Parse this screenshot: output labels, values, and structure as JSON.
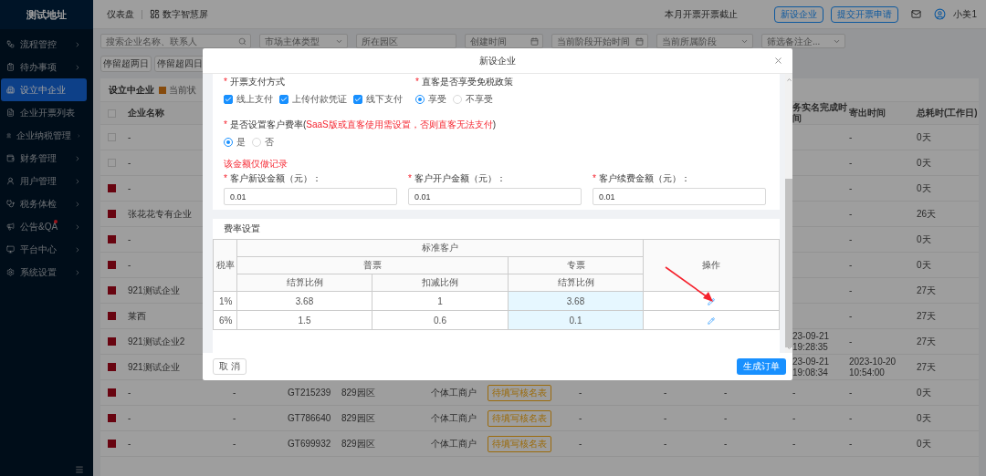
{
  "sidebar": {
    "title": "测试地址",
    "items": [
      {
        "label": "流程管控",
        "selected": false,
        "expandable": true,
        "badge": false
      },
      {
        "label": "待办事项",
        "selected": false,
        "expandable": true,
        "badge": false
      },
      {
        "label": "设立中企业",
        "selected": true,
        "expandable": false,
        "badge": false
      },
      {
        "label": "企业开票列表",
        "selected": false,
        "expandable": false,
        "badge": false
      },
      {
        "label": "企业纳税管理",
        "selected": false,
        "expandable": true,
        "badge": false
      },
      {
        "label": "财务管理",
        "selected": false,
        "expandable": true,
        "badge": false
      },
      {
        "label": "用户管理",
        "selected": false,
        "expandable": true,
        "badge": false
      },
      {
        "label": "税务体检",
        "selected": false,
        "expandable": true,
        "badge": false
      },
      {
        "label": "公告&QA",
        "selected": false,
        "expandable": true,
        "badge": true
      },
      {
        "label": "平台中心",
        "selected": false,
        "expandable": true,
        "badge": false
      },
      {
        "label": "系统设置",
        "selected": false,
        "expandable": true,
        "badge": false
      }
    ]
  },
  "header": {
    "tabs": [
      {
        "label": "仪表盘",
        "kind": "text"
      },
      {
        "label": "数字智慧屏",
        "kind": "screen"
      }
    ],
    "notice": "本月开票开票截止",
    "buttons": [
      "新设企业",
      "提交开票申请"
    ],
    "user": "小美1"
  },
  "filters": {
    "search": {
      "placeholder": "搜索企业名称、联系人"
    },
    "fields": [
      {
        "kind": "select",
        "placeholder": "市场主体类型"
      },
      {
        "kind": "text",
        "placeholder": "所在园区"
      },
      {
        "kind": "date",
        "placeholder": "创建时间"
      },
      {
        "kind": "date",
        "placeholder": "当前阶段开始时间"
      },
      {
        "kind": "select",
        "placeholder": "当前所属阶段"
      },
      {
        "kind": "select",
        "placeholder": "筛选备注企..."
      }
    ],
    "quick_buttons": [
      "停留超两日",
      "停留超四日"
    ]
  },
  "list": {
    "title": "设立中企业",
    "legend": "当前状",
    "select_all": {
      "checked": false
    },
    "headers": {
      "name": "企业名称",
      "column_9": "务实名完成时间",
      "column_10": "寄出时间",
      "column_11": "总耗时(工作日)"
    },
    "rows": [
      {
        "marked": false,
        "name": "-",
        "column_10": "-",
        "column_11": "0天"
      },
      {
        "marked": false,
        "name": "-",
        "column_10": "-",
        "column_11": "0天"
      },
      {
        "marked": true,
        "name": "-",
        "column_10": "-",
        "column_11": "0天"
      },
      {
        "marked": true,
        "name": "张花花专有企业",
        "column_10": "-",
        "column_11": "26天"
      },
      {
        "marked": true,
        "name": "-",
        "column_10": "-",
        "column_11": "0天"
      },
      {
        "marked": true,
        "name": "-",
        "column_10": "-",
        "column_11": "0天"
      },
      {
        "marked": true,
        "name": "921测试企业",
        "column_10": "-",
        "column_11": "27天"
      },
      {
        "marked": true,
        "name": "莱西",
        "column_10": "-",
        "column_11": "27天"
      },
      {
        "marked": true,
        "name": "921测试企业2",
        "column_9": "23-09-21 19:28:35",
        "column_10": "-",
        "column_11": "27天"
      },
      {
        "marked": true,
        "name": "921测试企业",
        "column_9": "23-09-21 19:08:34",
        "column_10": "2023-10-20 10:54:00",
        "column_11": "27天"
      },
      {
        "marked": true,
        "name": "-",
        "middle": [
          {
            "kind": "text",
            "text": "-"
          },
          {
            "kind": "text",
            "text": "GT215239"
          },
          {
            "kind": "text",
            "text": "829园区"
          },
          {
            "kind": "text",
            "text": "个体工商户"
          },
          {
            "kind": "tag",
            "text": "待填写核名表"
          },
          {
            "kind": "text",
            "text": "-"
          },
          {
            "kind": "text",
            "text": "-"
          },
          {
            "kind": "text",
            "text": "-"
          }
        ],
        "column_9": "-",
        "column_10": "-",
        "column_11": "0天"
      },
      {
        "marked": true,
        "name": "-",
        "middle": [
          {
            "kind": "text",
            "text": "-"
          },
          {
            "kind": "text",
            "text": "GT786640"
          },
          {
            "kind": "text",
            "text": "829园区"
          },
          {
            "kind": "text",
            "text": "个体工商户"
          },
          {
            "kind": "tag",
            "text": "待填写核名表"
          },
          {
            "kind": "text",
            "text": "-"
          },
          {
            "kind": "text",
            "text": "-"
          },
          {
            "kind": "text",
            "text": "-"
          }
        ],
        "column_9": "-",
        "column_10": "-",
        "column_11": "0天"
      },
      {
        "marked": true,
        "name": "-",
        "middle": [
          {
            "kind": "text",
            "text": "-"
          },
          {
            "kind": "text",
            "text": "GT699932"
          },
          {
            "kind": "text",
            "text": "829园区"
          },
          {
            "kind": "text",
            "text": "个体工商户"
          },
          {
            "kind": "tag",
            "text": "待填写核名表"
          },
          {
            "kind": "text",
            "text": "-"
          },
          {
            "kind": "text",
            "text": "-"
          },
          {
            "kind": "text",
            "text": "-"
          }
        ],
        "column_9": "-",
        "column_10": "-",
        "column_11": "0天"
      }
    ]
  },
  "modal": {
    "title": "新设企业",
    "payment": {
      "mark": "*",
      "label": "开票支付方式",
      "options": [
        {
          "label": "线上支付",
          "checked": true
        },
        {
          "label": "上传付款凭证",
          "checked": true
        },
        {
          "label": "线下支付",
          "checked": true
        }
      ]
    },
    "tax_exempt": {
      "mark": "*",
      "label": "直客是否享受免税政策",
      "options": [
        {
          "label": "享受",
          "selected": true
        },
        {
          "label": "不享受",
          "selected": false
        }
      ]
    },
    "rate_setting": {
      "mark": "*",
      "label": "是否设置客户费率(",
      "note": "SaaS版或直客使用需设置，否则直客无法支付",
      "label_end": ")",
      "options": [
        {
          "label": "是",
          "selected": true
        },
        {
          "label": "否",
          "selected": false
        }
      ]
    },
    "record_note": "该金额仅做记录",
    "amounts": [
      {
        "mark": "*",
        "label": "客户新设金额（元）：",
        "value": "0.01"
      },
      {
        "mark": "*",
        "label": "客户开户金额（元）：",
        "value": "0.01"
      },
      {
        "mark": "*",
        "label": "客户续费金额（元）：",
        "value": "0.01"
      }
    ],
    "fee_table": {
      "title": "费率设置",
      "headers": {
        "tax_rate": "税率",
        "group": "标准客户",
        "normal": "普票",
        "special": "专票",
        "settle": "结算比例",
        "deduct": "扣减比例",
        "special_settle": "结算比例",
        "action": "操作"
      },
      "rows": [
        {
          "tax_rate": "1%",
          "settle": "3.68",
          "deduct": "1",
          "special_settle": "3.68",
          "arrow": true
        },
        {
          "tax_rate": "6%",
          "settle": "1.5",
          "deduct": "0.6",
          "special_settle": "0.1",
          "arrow": false
        }
      ]
    },
    "buttons": {
      "cancel": "取 消",
      "submit": "生成订单"
    }
  }
}
